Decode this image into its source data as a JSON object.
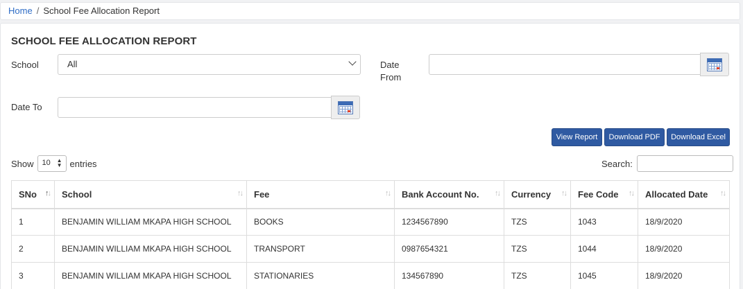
{
  "breadcrumb": {
    "home": "Home",
    "separator": "/",
    "current": "School Fee Allocation Report"
  },
  "page": {
    "title": "SCHOOL FEE ALLOCATION REPORT"
  },
  "filters": {
    "school_label": "School",
    "school_value": "All",
    "date_from_label_1": "Date",
    "date_from_label_2": "From",
    "date_from_value": "",
    "date_to_label": "Date To",
    "date_to_value": ""
  },
  "actions": {
    "view_report": "View Report",
    "download_pdf": "Download PDF",
    "download_excel": "Download Excel"
  },
  "colors": {
    "button_bg": "#2f5aa2",
    "link": "#2f6dc6"
  },
  "table_controls": {
    "show_label": "Show",
    "entries_value": "10",
    "entries_label": "entries",
    "search_label": "Search:",
    "search_value": ""
  },
  "table": {
    "columns": [
      "SNo",
      "School",
      "Fee",
      "Bank Account No.",
      "Currency",
      "Fee Code",
      "Allocated Date"
    ],
    "rows": [
      [
        "1",
        "BENJAMIN WILLIAM MKAPA HIGH SCHOOL",
        "BOOKS",
        "1234567890",
        "TZS",
        "1043",
        "18/9/2020"
      ],
      [
        "2",
        "BENJAMIN WILLIAM MKAPA HIGH SCHOOL",
        "TRANSPORT",
        "0987654321",
        "TZS",
        "1044",
        "18/9/2020"
      ],
      [
        "3",
        "BENJAMIN WILLIAM MKAPA HIGH SCHOOL",
        "STATIONARIES",
        "134567890",
        "TZS",
        "1045",
        "18/9/2020"
      ]
    ]
  }
}
